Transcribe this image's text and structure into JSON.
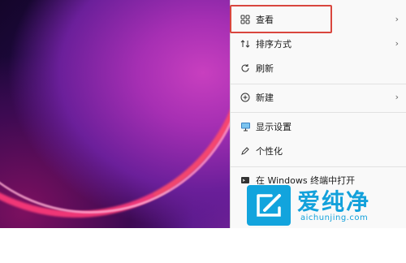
{
  "context_menu": {
    "items": [
      {
        "label": "查看",
        "icon": "view-grid-icon",
        "has_submenu": true
      },
      {
        "label": "排序方式",
        "icon": "sort-icon",
        "has_submenu": true
      },
      {
        "label": "刷新",
        "icon": "refresh-icon",
        "has_submenu": false
      },
      {
        "label": "新建",
        "icon": "new-plus-icon",
        "has_submenu": true
      },
      {
        "label": "显示设置",
        "icon": "display-settings-icon",
        "has_submenu": false
      },
      {
        "label": "个性化",
        "icon": "personalize-pen-icon",
        "has_submenu": false
      },
      {
        "label": "在 Windows 终端中打开",
        "icon": "terminal-icon",
        "has_submenu": false
      }
    ],
    "chevron": "›"
  },
  "watermark": {
    "name": "爱纯净",
    "url": "aichunjing.com"
  },
  "colors": {
    "highlight_border": "#d9463e",
    "watermark_blue": "#13a1db"
  }
}
